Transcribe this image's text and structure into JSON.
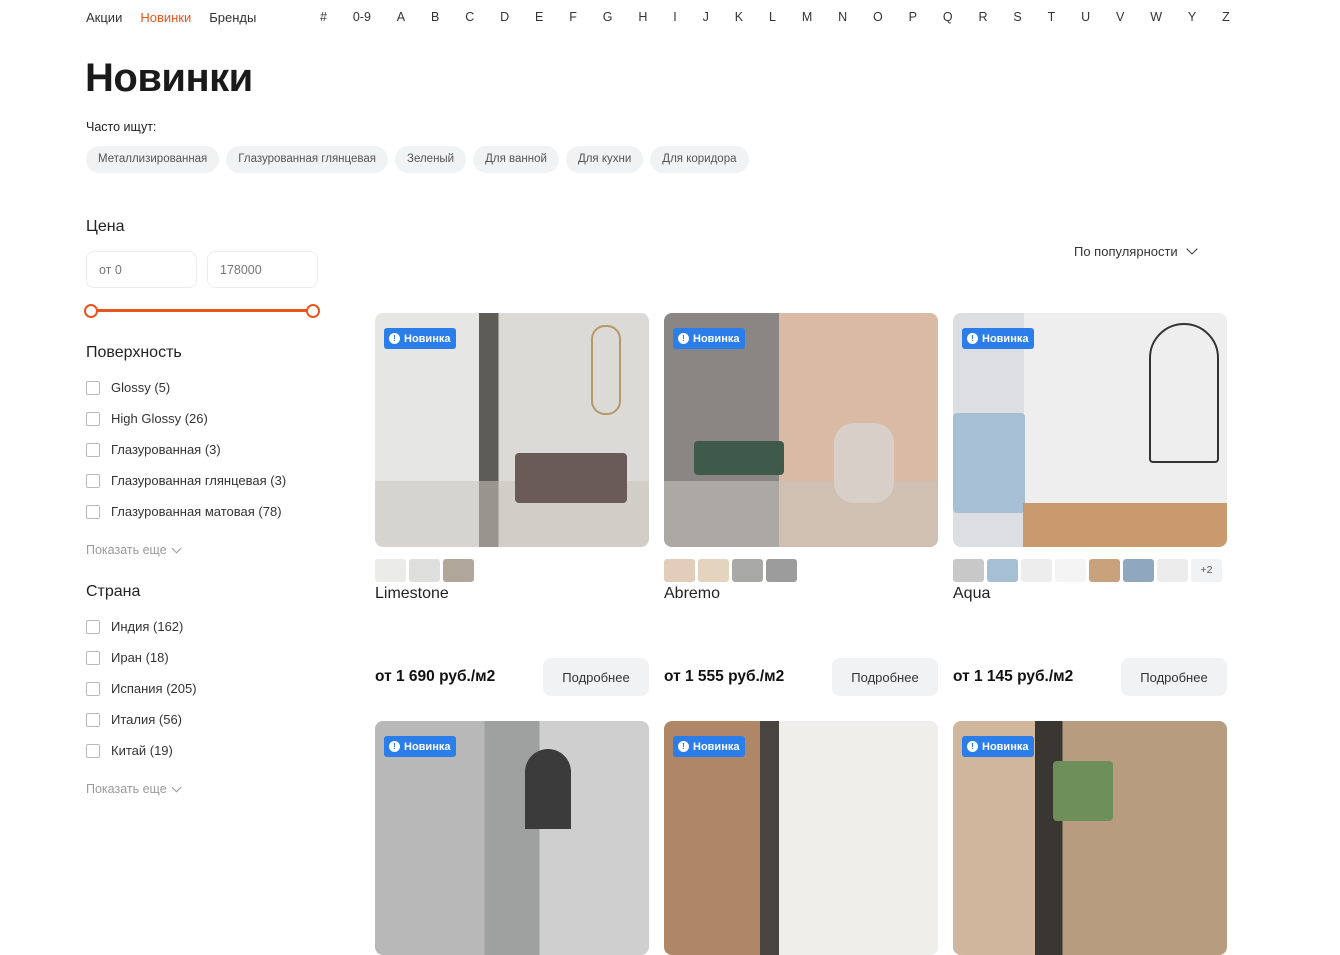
{
  "nav": {
    "items": [
      {
        "label": "Акции",
        "active": false
      },
      {
        "label": "Новинки",
        "active": true
      },
      {
        "label": "Бренды",
        "active": false
      }
    ],
    "letters": [
      "#",
      "0-9",
      "A",
      "B",
      "C",
      "D",
      "E",
      "F",
      "G",
      "H",
      "I",
      "J",
      "K",
      "L",
      "M",
      "N",
      "O",
      "P",
      "Q",
      "R",
      "S",
      "T",
      "U",
      "V",
      "W",
      "Y",
      "Z"
    ]
  },
  "page": {
    "title": "Новинки",
    "often_label": "Часто ищут:",
    "chips": [
      "Металлизированная",
      "Глазурованная глянцевая",
      "Зеленый",
      "Для ванной",
      "Для кухни",
      "Для коридора"
    ]
  },
  "filters": {
    "price": {
      "title": "Цена",
      "from_placeholder": "от 0",
      "to_placeholder": "178000"
    },
    "surface": {
      "title": "Поверхность",
      "options": [
        "Glossy (5)",
        "High Glossy (26)",
        "Глазурованная (3)",
        "Глазурованная глянцевая (3)",
        "Глазурованная матовая (78)"
      ],
      "more": "Показать еще"
    },
    "country": {
      "title": "Страна",
      "options": [
        "Индия (162)",
        "Иран (18)",
        "Испания (205)",
        "Италия (56)",
        "Китай (19)"
      ],
      "more": "Показать еще"
    }
  },
  "sort": {
    "label": "По популярности"
  },
  "badge_label": "Новинка",
  "details_label": "Подробнее",
  "colors": {
    "accent": "#e8561e",
    "badge": "#2b7de9"
  },
  "products": [
    {
      "name": "Limestone",
      "price": "от 1 690 руб./м2",
      "swatches": [
        "#ebebea",
        "#dedfdc",
        "#b0a699"
      ],
      "more": ""
    },
    {
      "name": "Abremo",
      "price": "от 1 555 руб./м2",
      "swatches": [
        "#e2cdbb",
        "#e4d4bf",
        "#a8a8a6",
        "#9c9c9c"
      ],
      "more": ""
    },
    {
      "name": "Aqua",
      "price": "от 1 145 руб./м2",
      "swatches": [
        "#c8c8c8",
        "#a7bfd4",
        "#ededed",
        "#f4f4f4",
        "#c8a27c",
        "#8fa8c0",
        "#ececec"
      ],
      "more": "+2"
    },
    {
      "name": "",
      "price": "",
      "swatches": [],
      "more": ""
    },
    {
      "name": "",
      "price": "",
      "swatches": [],
      "more": ""
    },
    {
      "name": "",
      "price": "",
      "swatches": [],
      "more": ""
    }
  ]
}
